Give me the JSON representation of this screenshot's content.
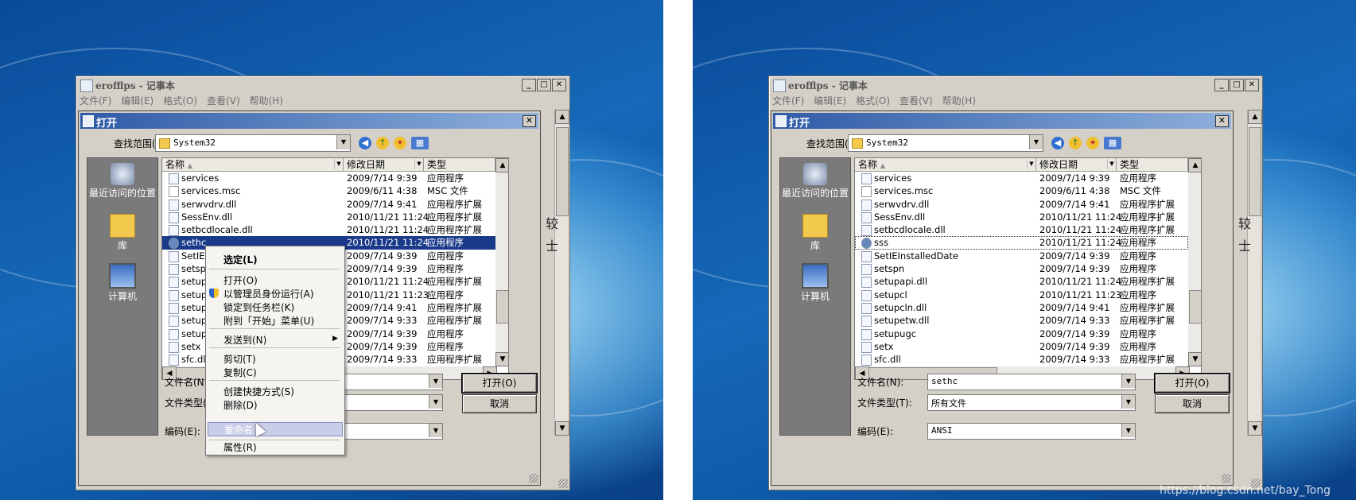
{
  "common": {
    "notepad_title": "erofflps - 记事本",
    "menu": [
      "文件(F)",
      "编辑(E)",
      "格式(O)",
      "查看(V)",
      "帮助(H)"
    ],
    "dialog_title": "打开",
    "lookin_label": "查找范围(I):",
    "lookin_value": "System32",
    "places": [
      "最近访问的位置",
      "库",
      "计算机"
    ],
    "col_name": "名称",
    "col_date": "修改日期",
    "col_type": "类型",
    "filename_label": "文件名(N):",
    "filetype_label": "文件类型(T):",
    "encoding_label": "编码(E):",
    "encoding_value": "ANSI",
    "open_button": "打开(O)",
    "cancel_button": "取消",
    "side_char_1": "较",
    "side_char_2": "士"
  },
  "left": {
    "rows": [
      {
        "name": "services",
        "date": "2009/7/14 9:39",
        "type": "应用程序"
      },
      {
        "name": "services.msc",
        "date": "2009/6/11 4:38",
        "type": "MSC 文件"
      },
      {
        "name": "serwvdrv.dll",
        "date": "2009/7/14 9:41",
        "type": "应用程序扩展"
      },
      {
        "name": "SessEnv.dll",
        "date": "2010/11/21 11:24",
        "type": "应用程序扩展"
      },
      {
        "name": "setbcdlocale.dll",
        "date": "2010/11/21 11:24",
        "type": "应用程序扩展"
      },
      {
        "name": "sethc",
        "date": "2010/11/21 11:24",
        "type": "应用程序"
      },
      {
        "name": "SetIE",
        "date": "2009/7/14 9:39",
        "type": "应用程序"
      },
      {
        "name": "setsp",
        "date": "2009/7/14 9:39",
        "type": "应用程序"
      },
      {
        "name": "setup",
        "date": "2010/11/21 11:24",
        "type": "应用程序扩展"
      },
      {
        "name": "setup",
        "date": "2010/11/21 11:23",
        "type": "应用程序"
      },
      {
        "name": "setup",
        "date": "2009/7/14 9:41",
        "type": "应用程序扩展"
      },
      {
        "name": "setup",
        "date": "2009/7/14 9:33",
        "type": "应用程序扩展"
      },
      {
        "name": "setup",
        "date": "2009/7/14 9:39",
        "type": "应用程序"
      },
      {
        "name": "setx",
        "date": "2009/7/14 9:39",
        "type": "应用程序"
      },
      {
        "name": "sfc.dll",
        "date": "2009/7/14 9:33",
        "type": "应用程序扩展"
      }
    ],
    "context_menu": {
      "select": "选定(L)",
      "open": "打开(O)",
      "run_as_admin": "以管理员身份运行(A)",
      "pin_taskbar": "锁定到任务栏(K)",
      "pin_start": "附到「开始」菜单(U)",
      "send_to": "发送到(N)",
      "cut": "剪切(T)",
      "copy": "复制(C)",
      "create_shortcut": "创建快捷方式(S)",
      "delete": "删除(D)",
      "rename": "重命名",
      "properties": "属性(R)"
    }
  },
  "right": {
    "rows": [
      {
        "name": "services",
        "date": "2009/7/14 9:39",
        "type": "应用程序"
      },
      {
        "name": "services.msc",
        "date": "2009/6/11 4:38",
        "type": "MSC 文件"
      },
      {
        "name": "serwvdrv.dll",
        "date": "2009/7/14 9:41",
        "type": "应用程序扩展"
      },
      {
        "name": "SessEnv.dll",
        "date": "2010/11/21 11:24",
        "type": "应用程序扩展"
      },
      {
        "name": "setbcdlocale.dll",
        "date": "2010/11/21 11:24",
        "type": "应用程序扩展"
      },
      {
        "name": "sss",
        "date": "2010/11/21 11:24",
        "type": "应用程序"
      },
      {
        "name": "SetIEInstalledDate",
        "date": "2009/7/14 9:39",
        "type": "应用程序"
      },
      {
        "name": "setspn",
        "date": "2009/7/14 9:39",
        "type": "应用程序"
      },
      {
        "name": "setupapi.dll",
        "date": "2010/11/21 11:24",
        "type": "应用程序扩展"
      },
      {
        "name": "setupcl",
        "date": "2010/11/21 11:23",
        "type": "应用程序"
      },
      {
        "name": "setupcln.dll",
        "date": "2009/7/14 9:41",
        "type": "应用程序扩展"
      },
      {
        "name": "setupetw.dll",
        "date": "2009/7/14 9:33",
        "type": "应用程序扩展"
      },
      {
        "name": "setupugc",
        "date": "2009/7/14 9:39",
        "type": "应用程序"
      },
      {
        "name": "setx",
        "date": "2009/7/14 9:39",
        "type": "应用程序"
      },
      {
        "name": "sfc.dll",
        "date": "2009/7/14 9:33",
        "type": "应用程序扩展"
      }
    ],
    "filename_value": "sethc",
    "filetype_value": "所有文件",
    "watermark": "https://blog.csdn.net/bay_Tong"
  }
}
